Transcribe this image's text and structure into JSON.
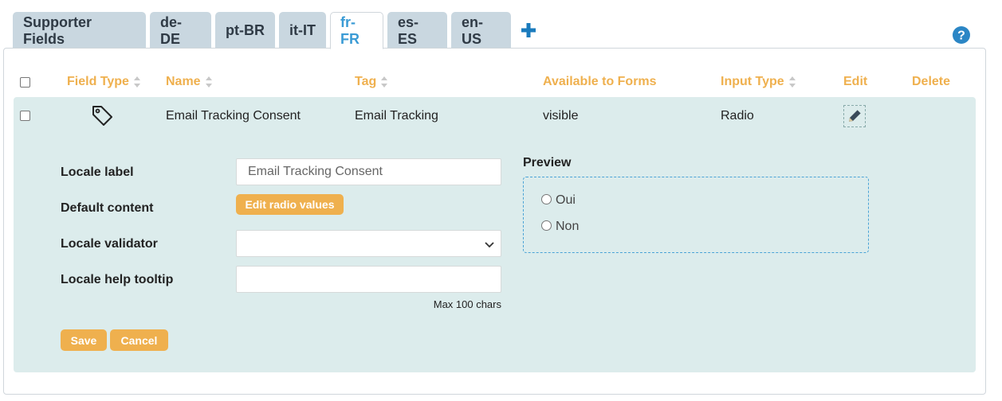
{
  "tabs": [
    {
      "label": "Supporter Fields",
      "active": false
    },
    {
      "label": "de-DE",
      "active": false
    },
    {
      "label": "pt-BR",
      "active": false
    },
    {
      "label": "it-IT",
      "active": false
    },
    {
      "label": "fr-FR",
      "active": true
    },
    {
      "label": "es-ES",
      "active": false
    },
    {
      "label": "en-US",
      "active": false
    }
  ],
  "colors": {
    "accent_orange": "#efb04e",
    "active_tab_blue": "#3a9bd5",
    "tab_bg": "#c9d7e0",
    "row_bg": "#dcecec",
    "help_blue": "#2b86c5"
  },
  "table": {
    "headers": {
      "field_type": "Field Type",
      "name": "Name",
      "tag": "Tag",
      "available_to_forms": "Available to Forms",
      "input_type": "Input Type",
      "edit": "Edit",
      "delete": "Delete"
    },
    "row": {
      "name": "Email Tracking Consent",
      "tag": "Email Tracking",
      "available_to_forms": "visible",
      "input_type": "Radio"
    }
  },
  "form": {
    "locale_label": {
      "label": "Locale label",
      "value": "Email Tracking Consent"
    },
    "default_content": {
      "label": "Default content",
      "button": "Edit radio values"
    },
    "locale_validator": {
      "label": "Locale validator",
      "value": ""
    },
    "locale_help_tooltip": {
      "label": "Locale help tooltip",
      "value": "",
      "hint": "Max 100 chars"
    },
    "save_label": "Save",
    "cancel_label": "Cancel"
  },
  "preview": {
    "title": "Preview",
    "options": [
      "Oui",
      "Non"
    ]
  }
}
